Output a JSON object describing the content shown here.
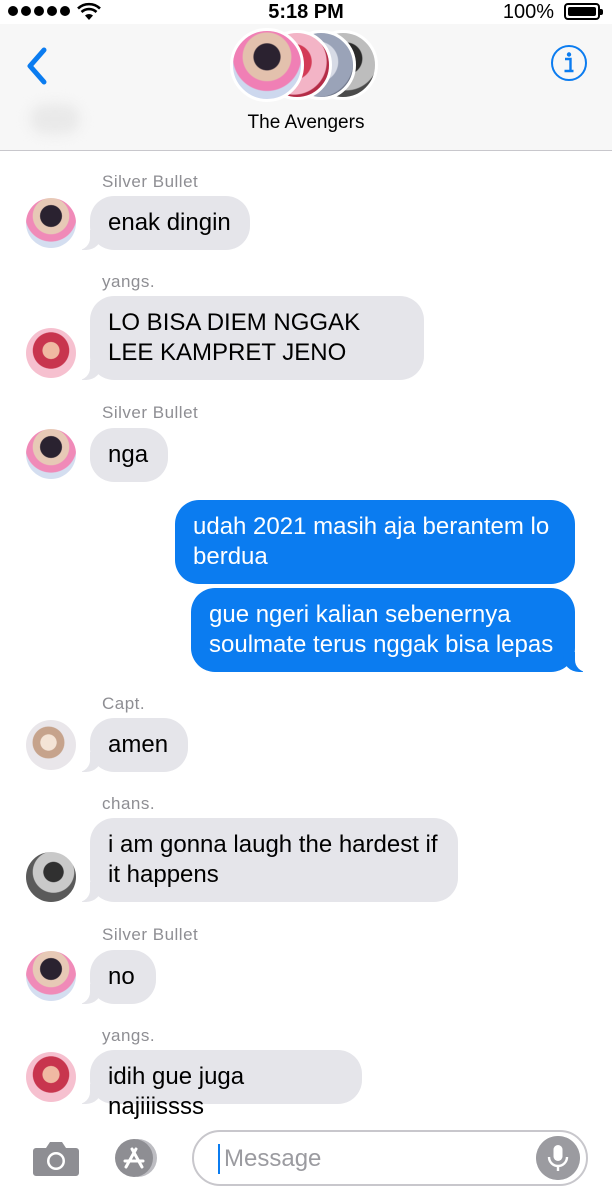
{
  "status_bar": {
    "time": "5:18 PM",
    "battery": "100%"
  },
  "header": {
    "title": "The Avengers"
  },
  "messages": [
    {
      "sender": "Silver Bullet",
      "text": "enak dingin"
    },
    {
      "sender": "yangs.",
      "text": "LO BISA DIEM NGGAK LEE KAMPRET JENO"
    },
    {
      "sender": "Silver Bullet",
      "text": "nga"
    },
    {
      "sender": "",
      "text": "udah 2021 masih aja berantem lo berdua"
    },
    {
      "sender": "",
      "text": "gue ngeri kalian sebenernya soulmate terus nggak bisa lepas"
    },
    {
      "sender": "Capt.",
      "text": "amen"
    },
    {
      "sender": "chans.",
      "text": "i am gonna laugh the hardest if it happens"
    },
    {
      "sender": "Silver Bullet",
      "text": "no"
    },
    {
      "sender": "yangs.",
      "text": "idih gue juga najiiissss"
    }
  ],
  "input": {
    "placeholder": "Message"
  },
  "colors": {
    "accent": "#0b7cf0",
    "incoming_bubble": "#e5e5ea",
    "sender_label": "#8e8e93"
  },
  "icons": [
    "back-chevron-icon",
    "info-icon",
    "camera-icon",
    "app-store-icon",
    "microphone-icon"
  ]
}
